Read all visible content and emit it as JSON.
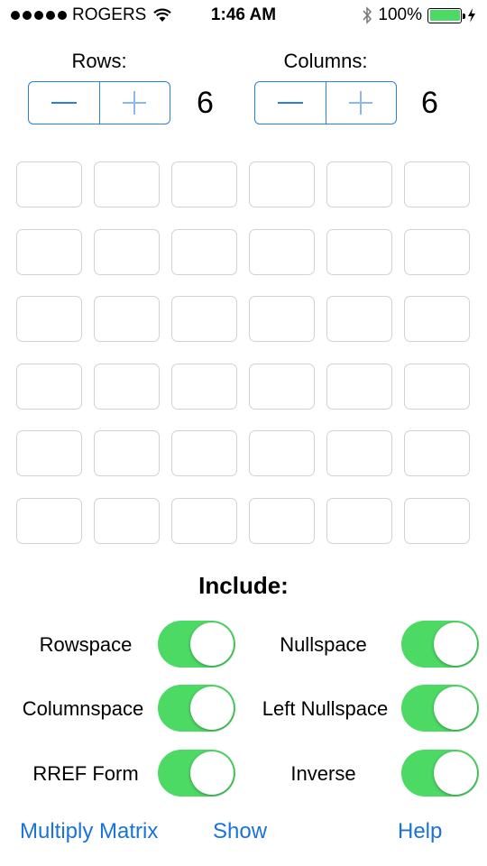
{
  "status_bar": {
    "carrier": "ROGERS",
    "time": "1:46 AM",
    "battery": "100%",
    "signal_bars": 5,
    "battery_level": 1.0
  },
  "rows": {
    "label": "Rows:",
    "value": "6"
  },
  "columns": {
    "label": "Columns:",
    "value": "6"
  },
  "matrix": {
    "cells": [
      [
        "",
        "",
        "",
        "",
        "",
        ""
      ],
      [
        "",
        "",
        "",
        "",
        "",
        ""
      ],
      [
        "",
        "",
        "",
        "",
        "",
        ""
      ],
      [
        "",
        "",
        "",
        "",
        "",
        ""
      ],
      [
        "",
        "",
        "",
        "",
        "",
        ""
      ],
      [
        "",
        "",
        "",
        "",
        "",
        ""
      ]
    ]
  },
  "include": {
    "title": "Include:",
    "options": [
      {
        "label": "Rowspace",
        "on": true
      },
      {
        "label": "Nullspace",
        "on": true
      },
      {
        "label": "Columnspace",
        "on": true
      },
      {
        "label": "Left Nullspace",
        "on": true
      },
      {
        "label": "RREF Form",
        "on": true
      },
      {
        "label": "Inverse",
        "on": true
      }
    ]
  },
  "actions": {
    "multiply": "Multiply Matrix",
    "show": "Show",
    "help": "Help"
  },
  "colors": {
    "accent": "#2a7fe0",
    "toggle_on": "#4cd964",
    "link": "#1a73d9"
  }
}
